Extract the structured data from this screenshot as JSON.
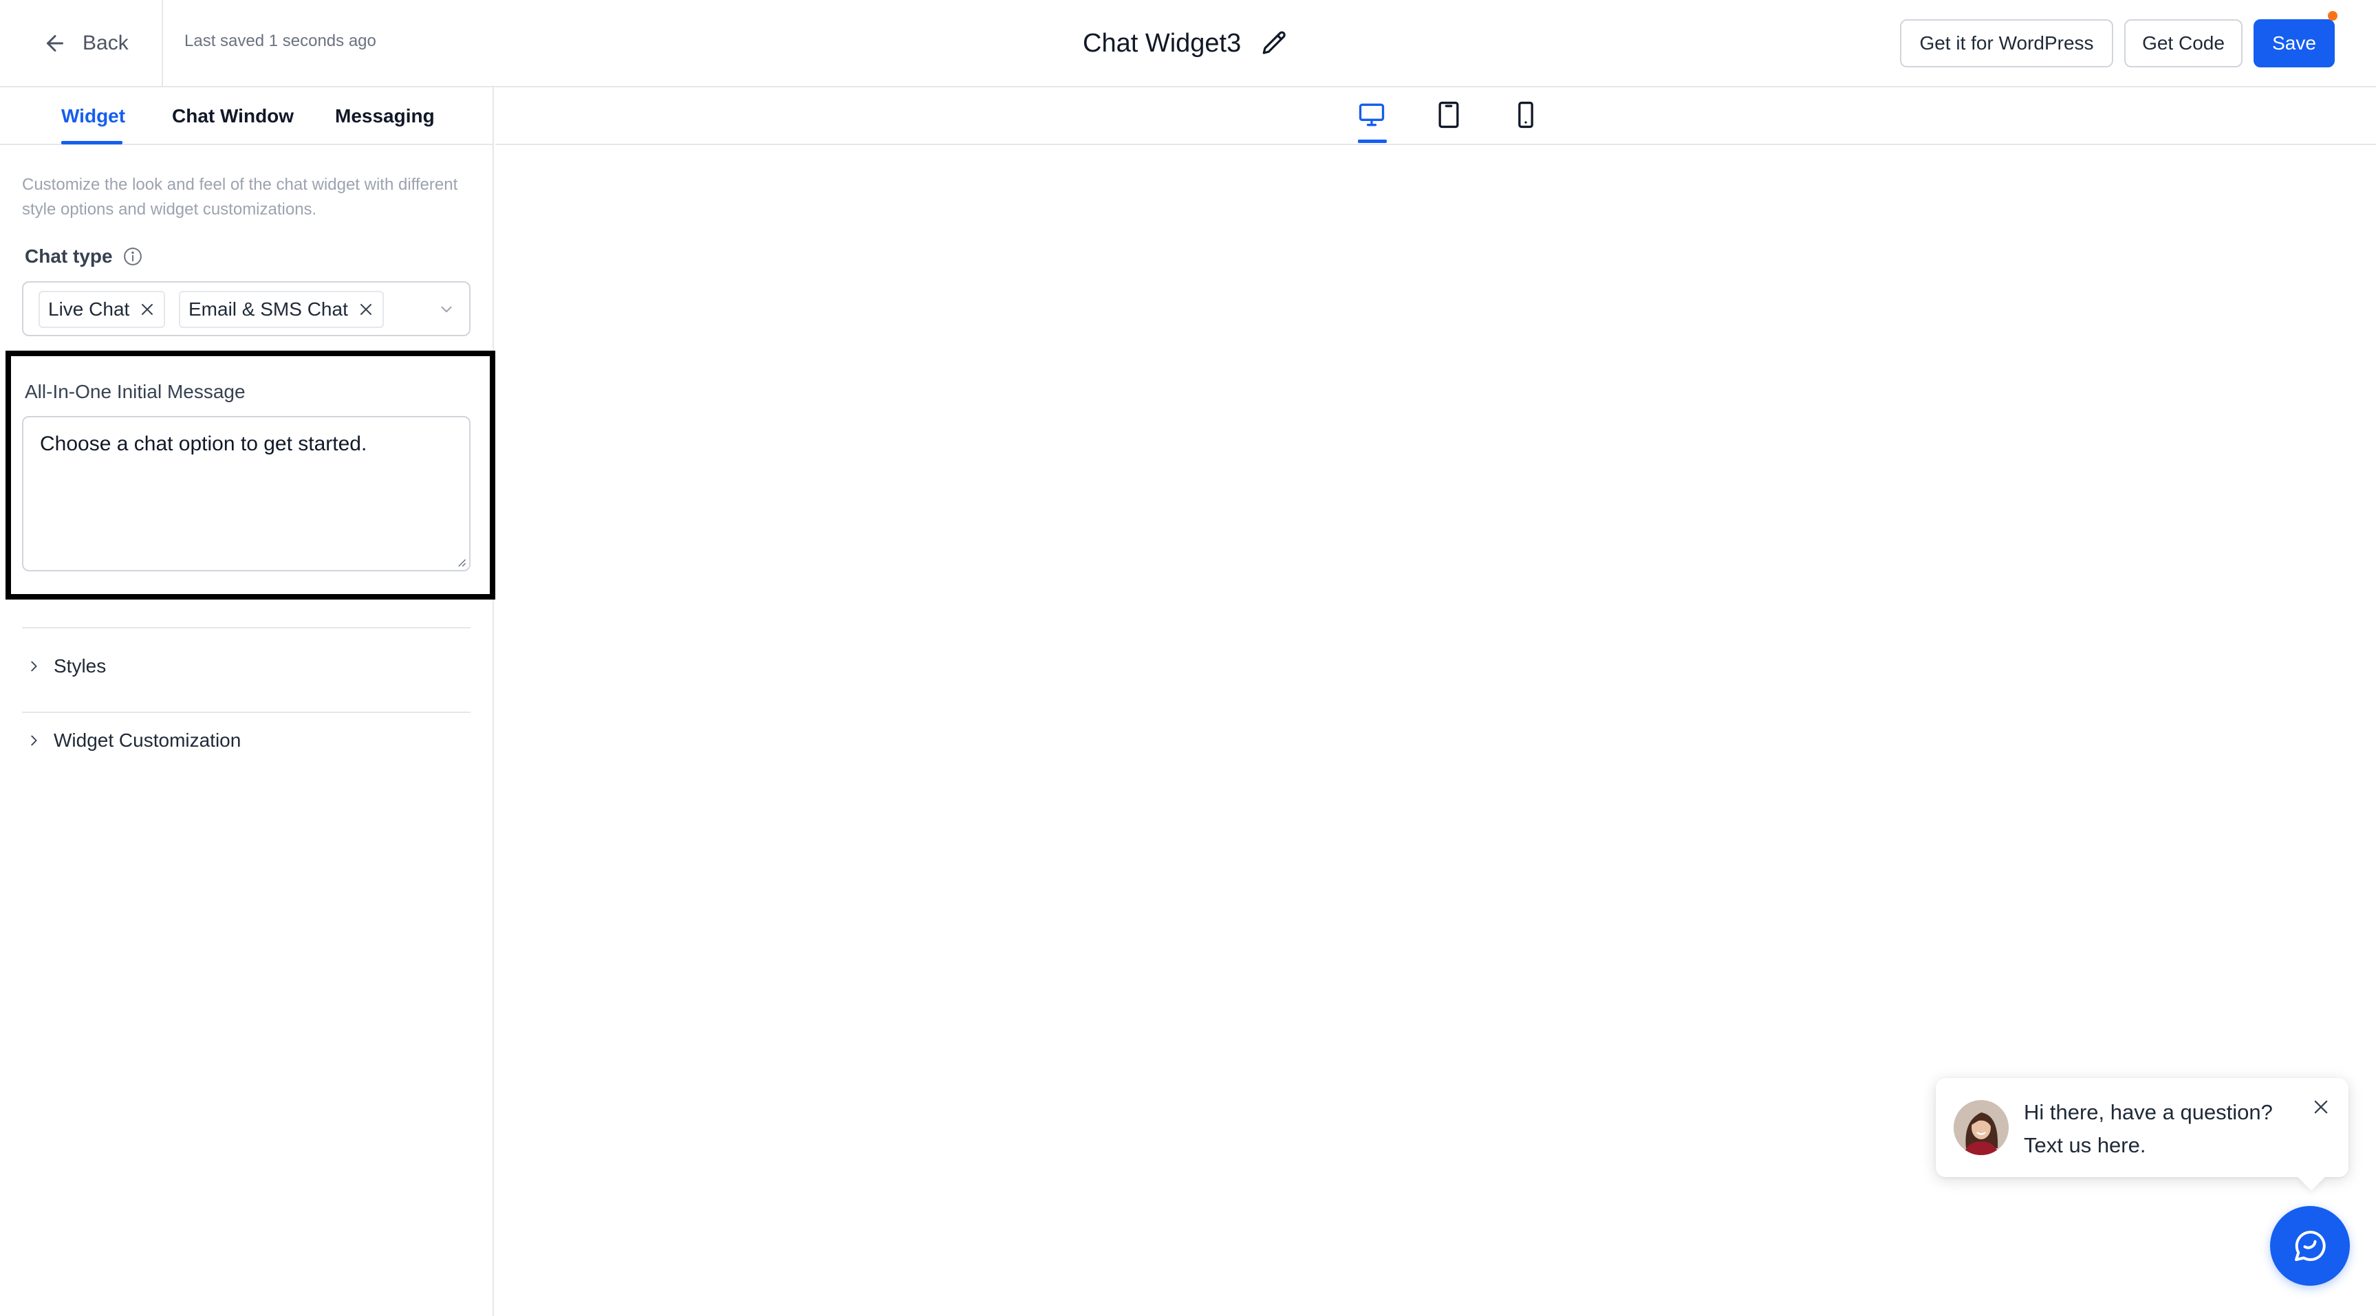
{
  "header": {
    "back_label": "Back",
    "last_saved": "Last saved 1 seconds ago",
    "title": "Chat Widget3",
    "wordpress_button": "Get it for WordPress",
    "get_code_button": "Get Code",
    "save_button": "Save"
  },
  "tabs": [
    {
      "label": "Widget",
      "active": true
    },
    {
      "label": "Chat Window",
      "active": false
    },
    {
      "label": "Messaging",
      "active": false
    }
  ],
  "widget_panel": {
    "description": "Customize the look and feel of the chat widget with different style options and widget customizations.",
    "chat_type": {
      "label": "Chat type",
      "selected": [
        "Live Chat",
        "Email & SMS Chat"
      ]
    },
    "initial_message": {
      "label": "All-In-One Initial Message",
      "value": "Choose a chat option to get started."
    },
    "sections": [
      {
        "label": "Styles"
      },
      {
        "label": "Widget Customization"
      }
    ]
  },
  "preview": {
    "devices": [
      "desktop-icon",
      "tablet-icon",
      "mobile-icon"
    ],
    "active_device": "desktop",
    "bubble_text_line1": "Hi there, have a question?",
    "bubble_text_line2": "Text us here."
  },
  "colors": {
    "accent": "#155eef",
    "notification_dot": "#f97316",
    "border": "#d1d5db",
    "highlight_border": "#000000"
  }
}
